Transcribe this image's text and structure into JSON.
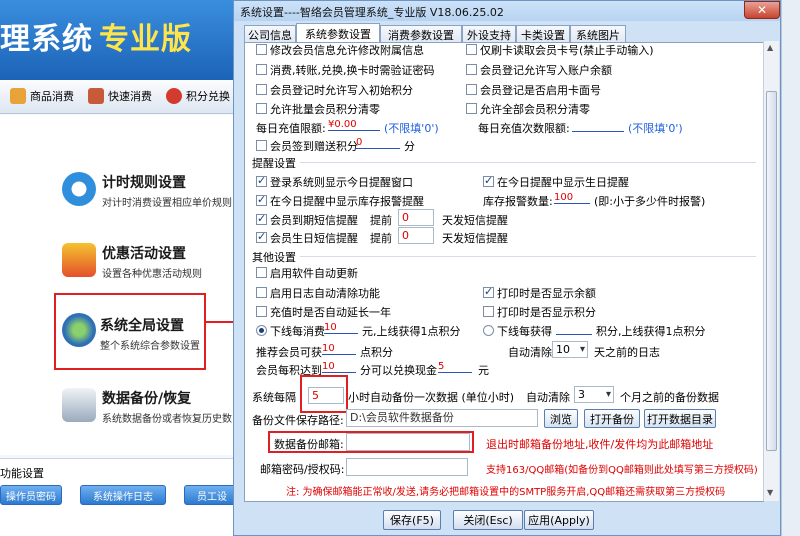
{
  "background": {
    "title_main": "理系统",
    "title_edition": "专业版",
    "toolbar": [
      "商品消费",
      "快速消费",
      "积分兑换"
    ],
    "items": [
      {
        "title": "计时规则设置",
        "desc": "对计时消费设置相应单价规则"
      },
      {
        "title": "优惠活动设置",
        "desc": "设置各种优惠活动规则"
      },
      {
        "title": "系统全局设置",
        "desc": "整个系统综合参数设置"
      },
      {
        "title": "数据备份/恢复",
        "desc": "系统数据备份或者恢复历史数"
      }
    ],
    "func_title": "功能设置",
    "func_buttons": [
      "操作员密码",
      "系统操作日志",
      "员工设"
    ]
  },
  "dialog": {
    "title": "系统设置----智络会员管理系统_专业版 V18.06.25.02",
    "close": "✕",
    "tabs": [
      "公司信息",
      "系统参数设置",
      "消费参数设置",
      "外设支持",
      "卡类设置",
      "系统图片"
    ],
    "active_tab": 1,
    "top_options": [
      {
        "label": "修改会员信息允许修改附属信息",
        "checked": false
      },
      {
        "label": "仅刷卡读取会员卡号(禁止手动输入)",
        "checked": false
      },
      {
        "label": "消费,转账,兑换,换卡时需验证密码",
        "checked": false
      },
      {
        "label": "会员登记允许写入账户余额",
        "checked": false
      },
      {
        "label": "会员登记时允许写入初始积分",
        "checked": false
      },
      {
        "label": "会员登记是否启用卡面号",
        "checked": false
      },
      {
        "label": "允许批量会员积分清零",
        "checked": false
      },
      {
        "label": "允许全部会员积分清零",
        "checked": false
      }
    ],
    "daily_limit_label": "每日充值限额:",
    "daily_limit_value": "¥0.00",
    "daily_limit_hint": "(不限填'0')",
    "daily_count_label": "每日充值次数限额:",
    "daily_count_hint": "(不限填'0')",
    "signin_label": "会员签到赠送积分",
    "signin_value": "0",
    "signin_unit": "分",
    "remind_section": "提醒设置",
    "remind_login": "登录系统则显示今日提醒窗口",
    "remind_birthday": "在今日提醒中显示生日提醒",
    "remind_stock": "在今日提醒中显示库存报警提醒",
    "stock_alarm_label": "库存报警数量:",
    "stock_alarm_value": "100",
    "stock_alarm_hint": "(即:小于多少件时报警)",
    "expire_sms": "会员到期短信提醒",
    "expire_before": "提前",
    "expire_days": "0",
    "expire_suffix": "天发短信提醒",
    "birthday_sms": "会员生日短信提醒",
    "birthday_before": "提前",
    "birthday_days": "0",
    "birthday_suffix": "天发短信提醒",
    "other_section": "其他设置",
    "auto_update": "启用软件自动更新",
    "log_clean": "启用日志自动清除功能",
    "print_balance": "打印时是否显示余额",
    "auto_extend": "充值时是否自动延长一年",
    "print_points": "打印时是否显示积分",
    "consume_points_label": "下线每消费",
    "consume_points_value": "10",
    "consume_points_suffix": "元,上线获得1点积分",
    "earn_points_label": "下线每获得",
    "earn_points_suffix": "积分,上线获得1点积分",
    "recommend_label": "推荐会员可获",
    "recommend_value": "10",
    "recommend_suffix": "点积分",
    "auto_clear_label": "自动清除",
    "auto_clear_value": "10",
    "auto_clear_suffix": "天之前的日志",
    "points_cash_label": "会员每积达到",
    "points_cash_value": "10",
    "points_cash_mid": "分可以兑换现金",
    "points_cash_amount": "5",
    "points_cash_suffix": "元",
    "backup_every_label": "系统每隔",
    "backup_every_value": "5",
    "backup_every_suffix": "小时自动备份一次数据 (单位小时)",
    "backup_clear_label": "自动清除",
    "backup_clear_value": "3",
    "backup_clear_suffix": "个月之前的备份数据",
    "backup_path_label": "备份文件保存路径:",
    "backup_path_value": "D:\\会员软件数据备份",
    "browse": "浏览",
    "open_backup": "打开备份",
    "open_data_dir": "打开数据目录",
    "email_label": "数据备份邮箱:",
    "email_value": "",
    "email_hint": "退出时邮箱备份地址,收件/发件均为此邮箱地址",
    "email_pwd_label": "邮箱密码/授权码:",
    "email_pwd_value": "",
    "email_pwd_hint": "支持163/QQ邮箱(如备份到QQ邮箱则此处填写第三方授权码)",
    "note": "注: 为确保邮箱能正常收/发送,请务必把邮箱设置中的SMTP服务开启,QQ邮箱还需获取第三方授权码",
    "save": "保存(F5)",
    "close_btn": "关闭(Esc)",
    "apply": "应用(Apply)"
  }
}
